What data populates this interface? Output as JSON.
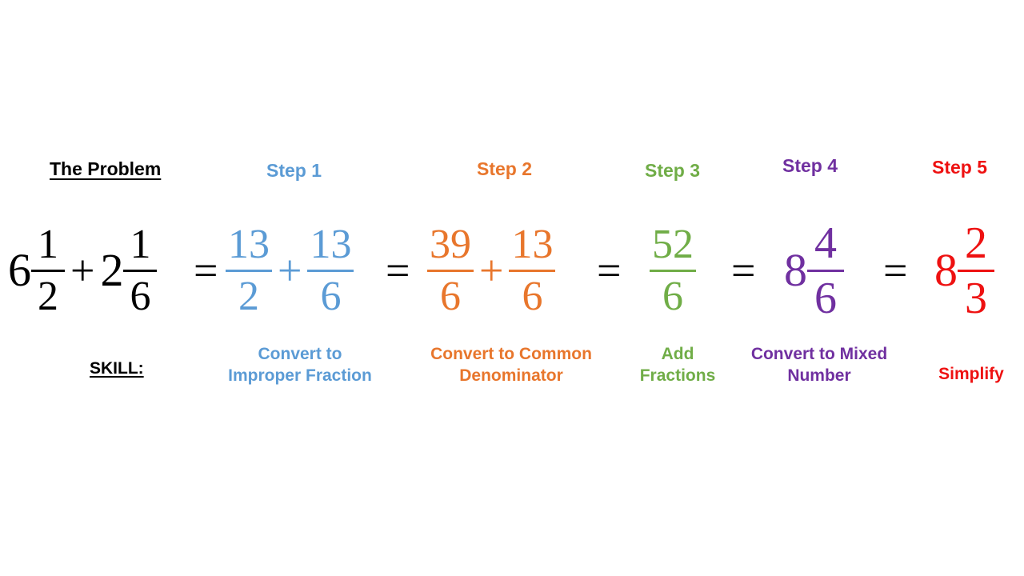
{
  "palette": {
    "black": "#000000",
    "blue": "#5B9BD5",
    "orange": "#E8762C",
    "green": "#70AD47",
    "purple": "#7030A0",
    "red": "#EE1111"
  },
  "headers": {
    "problem": "The Problem",
    "step1": "Step 1",
    "step2": "Step 2",
    "step3": "Step 3",
    "step4": "Step 4",
    "step5": "Step 5"
  },
  "skills": {
    "label": "SKILL:",
    "step1": "Convert to\nImproper Fraction",
    "step2": "Convert to Common\nDenominator",
    "step3": "Add\nFractions",
    "step4": "Convert to Mixed\nNumber",
    "step5": "Simplify"
  },
  "equation": {
    "problem": {
      "whole1": "6",
      "frac1_num": "1",
      "frac1_den": "2",
      "plus": "+",
      "whole2": "2",
      "frac2_num": "1",
      "frac2_den": "6"
    },
    "eq1": "=",
    "step1": {
      "frac1_num": "13",
      "frac1_den": "2",
      "plus": "+",
      "frac2_num": "13",
      "frac2_den": "6"
    },
    "eq2": "=",
    "step2": {
      "frac1_num": "39",
      "frac1_den": "6",
      "plus": "+",
      "frac2_num": "13",
      "frac2_den": "6"
    },
    "eq3": "=",
    "step3": {
      "frac_num": "52",
      "frac_den": "6"
    },
    "eq4": "=",
    "step4": {
      "whole": "8",
      "frac_num": "4",
      "frac_den": "6"
    },
    "eq5": "=",
    "step5": {
      "whole": "8",
      "frac_num": "2",
      "frac_den": "3"
    }
  }
}
